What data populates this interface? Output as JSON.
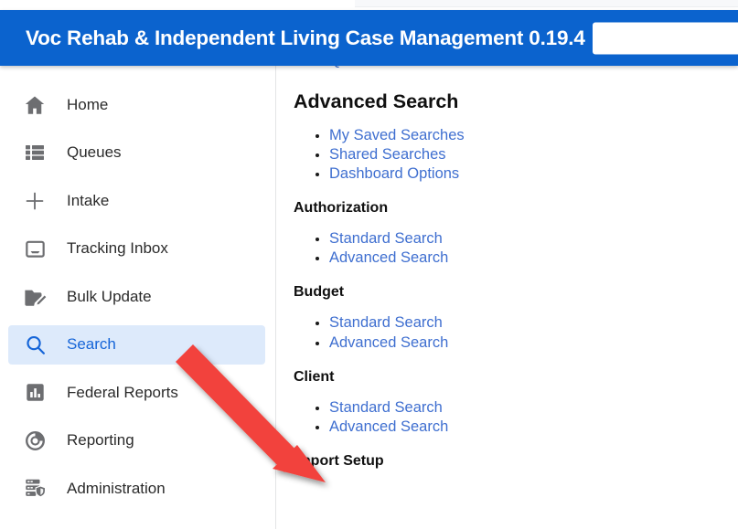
{
  "app": {
    "title": "Voc Rehab & Independent Living Case Management 0.19.4",
    "header_color": "#0b63ce",
    "link_color": "#3f6fd0",
    "active_bg_color": "#ddeafb",
    "active_text_color": "#1565d8",
    "annotation_color": "#f2433d"
  },
  "header": {
    "search": {
      "value": "",
      "placeholder": ""
    }
  },
  "sidebar": {
    "items": [
      {
        "label": "Home",
        "icon": "home-icon",
        "active": false
      },
      {
        "label": "Queues",
        "icon": "list-icon",
        "active": false
      },
      {
        "label": "Intake",
        "icon": "plus-icon",
        "active": false
      },
      {
        "label": "Tracking Inbox",
        "icon": "inbox-icon",
        "active": false
      },
      {
        "label": "Bulk Update",
        "icon": "folder-edit-icon",
        "active": false
      },
      {
        "label": "Search",
        "icon": "search-icon",
        "active": true
      },
      {
        "label": "Federal Reports",
        "icon": "bar-chart-icon",
        "active": false
      },
      {
        "label": "Reporting",
        "icon": "donut-chart-icon",
        "active": false
      },
      {
        "label": "Administration",
        "icon": "server-shield-icon",
        "active": false
      }
    ]
  },
  "main": {
    "top_partial_link": "Quick Search",
    "sections": [
      {
        "heading": "Advanced Search",
        "level": 2,
        "links": [
          "My Saved Searches",
          "Shared Searches",
          "Dashboard Options"
        ]
      },
      {
        "heading": "Authorization",
        "level": 3,
        "links": [
          "Standard Search",
          "Advanced Search"
        ]
      },
      {
        "heading": "Budget",
        "level": 3,
        "links": [
          "Standard Search",
          "Advanced Search"
        ]
      },
      {
        "heading": "Client",
        "level": 3,
        "links": [
          "Standard Search",
          "Advanced Search"
        ]
      },
      {
        "heading": "Import Setup",
        "level": 3,
        "links": []
      }
    ]
  }
}
